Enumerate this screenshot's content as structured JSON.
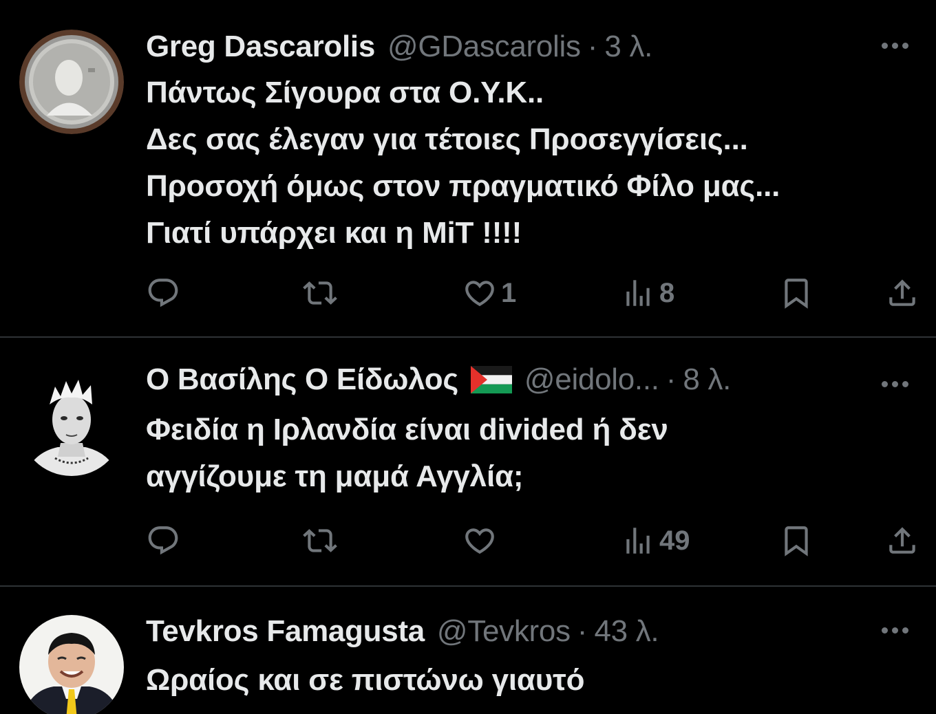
{
  "tweets": [
    {
      "name": "Greg Dascarolis",
      "handle": "@GDascarolis",
      "separator": "·",
      "time": "3 λ.",
      "lines": [
        "Πάντως Σίγουρα στα Ο.Υ.Κ..",
        "Δες σας έλεγαν για τέτοιες Προσεγγίσεις...",
        "Προσοχή όμως στον πραγματικό Φίλο μας...",
        "Γιατί υπάρχει και η ΜiΤ !!!!"
      ],
      "likes": "1",
      "views": "8"
    },
    {
      "name": "Ο Βασίλης Ο Είδωλος",
      "handle": "@eidolo...",
      "separator": "·",
      "time": "8 λ.",
      "flag_icon": "palestine-flag-icon",
      "lines": [
        "Φειδία η Ιρλανδία είναι divided ή δεν",
        "αγγίζουμε τη μαμά Αγγλία;"
      ],
      "likes": "",
      "views": "49"
    },
    {
      "name": "Tevkros Famagusta",
      "handle": "@Tevkros",
      "separator": "·",
      "time": "43 λ.",
      "lines": [
        "Ωραίος και σε πιστώνω γιαυτό"
      ]
    }
  ],
  "icons": [
    "reply-icon",
    "retweet-icon",
    "like-icon",
    "views-icon",
    "bookmark-icon",
    "share-icon",
    "more-icon"
  ],
  "colors": {
    "background": "#000000",
    "text": "#e7e9ea",
    "muted": "#71767b",
    "divider": "#2f3336"
  }
}
